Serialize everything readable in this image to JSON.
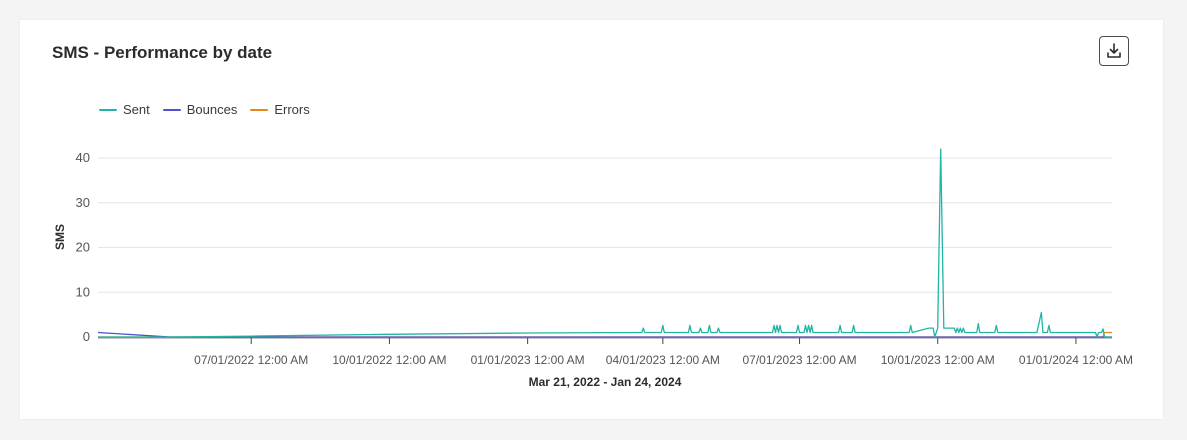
{
  "card": {
    "title": "SMS - Performance by date",
    "download_icon": "download-icon"
  },
  "colors": {
    "sent": "#21b5a6",
    "bounces": "#4d53c8",
    "errors": "#e68619",
    "grid": "#e6e6e6",
    "axis": "#8e8e8e",
    "text": "#555555"
  },
  "chart_data": {
    "type": "line",
    "title": "SMS - Performance by date",
    "ylabel": "SMS",
    "xlabel": "Mar 21, 2022 - Jan 24, 2024",
    "ylim": [
      0,
      45
    ],
    "xlim": [
      "2022-03-21",
      "2024-01-25"
    ],
    "yticks": [
      0,
      10,
      20,
      30,
      40
    ],
    "xticks": [
      {
        "date": "2022-07-01",
        "label": "07/01/2022 12:00 AM"
      },
      {
        "date": "2022-10-01",
        "label": "10/01/2022 12:00 AM"
      },
      {
        "date": "2023-01-01",
        "label": "01/01/2023 12:00 AM"
      },
      {
        "date": "2023-04-01",
        "label": "04/01/2023 12:00 AM"
      },
      {
        "date": "2023-07-01",
        "label": "07/01/2023 12:00 AM"
      },
      {
        "date": "2023-10-01",
        "label": "10/01/2023 12:00 AM"
      },
      {
        "date": "2024-01-01",
        "label": "01/01/2024 12:00 AM"
      }
    ],
    "grid": true,
    "legend_position": "top-left",
    "series": [
      {
        "name": "Sent",
        "points": [
          [
            "2022-03-21",
            0
          ],
          [
            "2022-05-08",
            0
          ],
          [
            "2022-07-01",
            0.2
          ],
          [
            "2022-10-01",
            0.6
          ],
          [
            "2023-01-01",
            0.9
          ],
          [
            "2023-03-15",
            1.0
          ],
          [
            "2023-03-18",
            1.0
          ],
          [
            "2023-03-19",
            2
          ],
          [
            "2023-03-20",
            1.0
          ],
          [
            "2023-03-31",
            1.0
          ],
          [
            "2023-04-01",
            2.6
          ],
          [
            "2023-04-02",
            1.0
          ],
          [
            "2023-04-18",
            1.0
          ],
          [
            "2023-04-19",
            2.6
          ],
          [
            "2023-04-20",
            1.0
          ],
          [
            "2023-04-25",
            1.0
          ],
          [
            "2023-04-26",
            2
          ],
          [
            "2023-04-27",
            1.0
          ],
          [
            "2023-05-01",
            1.0
          ],
          [
            "2023-05-02",
            2.6
          ],
          [
            "2023-05-03",
            1.0
          ],
          [
            "2023-05-07",
            1.0
          ],
          [
            "2023-05-08",
            2
          ],
          [
            "2023-05-09",
            1.0
          ],
          [
            "2023-06-13",
            1.0
          ],
          [
            "2023-06-14",
            2.6
          ],
          [
            "2023-06-15",
            1.0
          ],
          [
            "2023-06-16",
            2.6
          ],
          [
            "2023-06-17",
            1.0
          ],
          [
            "2023-06-18",
            2.6
          ],
          [
            "2023-06-19",
            1.0
          ],
          [
            "2023-06-29",
            1.0
          ],
          [
            "2023-06-30",
            2.6
          ],
          [
            "2023-07-01",
            1.0
          ],
          [
            "2023-07-04",
            1.0
          ],
          [
            "2023-07-05",
            2.6
          ],
          [
            "2023-07-06",
            1.0
          ],
          [
            "2023-07-07",
            2.6
          ],
          [
            "2023-07-08",
            1.0
          ],
          [
            "2023-07-09",
            2.6
          ],
          [
            "2023-07-10",
            1.0
          ],
          [
            "2023-07-27",
            1.0
          ],
          [
            "2023-07-28",
            2.6
          ],
          [
            "2023-07-29",
            1.0
          ],
          [
            "2023-08-05",
            1.0
          ],
          [
            "2023-08-06",
            2.6
          ],
          [
            "2023-08-07",
            1.0
          ],
          [
            "2023-09-12",
            1.0
          ],
          [
            "2023-09-13",
            2.6
          ],
          [
            "2023-09-14",
            1.0
          ],
          [
            "2023-09-25",
            2
          ],
          [
            "2023-09-28",
            2
          ],
          [
            "2023-09-29",
            0
          ],
          [
            "2023-10-01",
            2
          ],
          [
            "2023-10-03",
            42
          ],
          [
            "2023-10-05",
            2
          ],
          [
            "2023-10-12",
            2
          ],
          [
            "2023-10-13",
            1.0
          ],
          [
            "2023-10-14",
            2
          ],
          [
            "2023-10-15",
            1.0
          ],
          [
            "2023-10-16",
            2
          ],
          [
            "2023-10-17",
            1.0
          ],
          [
            "2023-10-18",
            2
          ],
          [
            "2023-10-19",
            1.0
          ],
          [
            "2023-10-27",
            1.0
          ],
          [
            "2023-10-28",
            3
          ],
          [
            "2023-10-29",
            1.0
          ],
          [
            "2023-11-08",
            1.0
          ],
          [
            "2023-11-09",
            2.6
          ],
          [
            "2023-11-10",
            1.0
          ],
          [
            "2023-12-06",
            1.0
          ],
          [
            "2023-12-09",
            5.5
          ],
          [
            "2023-12-10",
            1.0
          ],
          [
            "2023-12-13",
            1.0
          ],
          [
            "2023-12-14",
            2.6
          ],
          [
            "2023-12-15",
            1.0
          ],
          [
            "2024-01-14",
            1.0
          ],
          [
            "2024-01-15",
            0
          ],
          [
            "2024-01-16",
            1.0
          ],
          [
            "2024-01-18",
            1.0
          ],
          [
            "2024-01-19",
            1.8
          ],
          [
            "2024-01-20",
            0
          ],
          [
            "2024-01-25",
            0
          ]
        ]
      },
      {
        "name": "Bounces",
        "points": [
          [
            "2022-03-21",
            1.0
          ],
          [
            "2022-05-08",
            0
          ],
          [
            "2024-01-25",
            0
          ]
        ]
      },
      {
        "name": "Errors",
        "points": [
          [
            "2022-03-21",
            0
          ],
          [
            "2024-01-19",
            0
          ],
          [
            "2024-01-20",
            1.0
          ],
          [
            "2024-01-25",
            1.0
          ]
        ]
      }
    ]
  }
}
